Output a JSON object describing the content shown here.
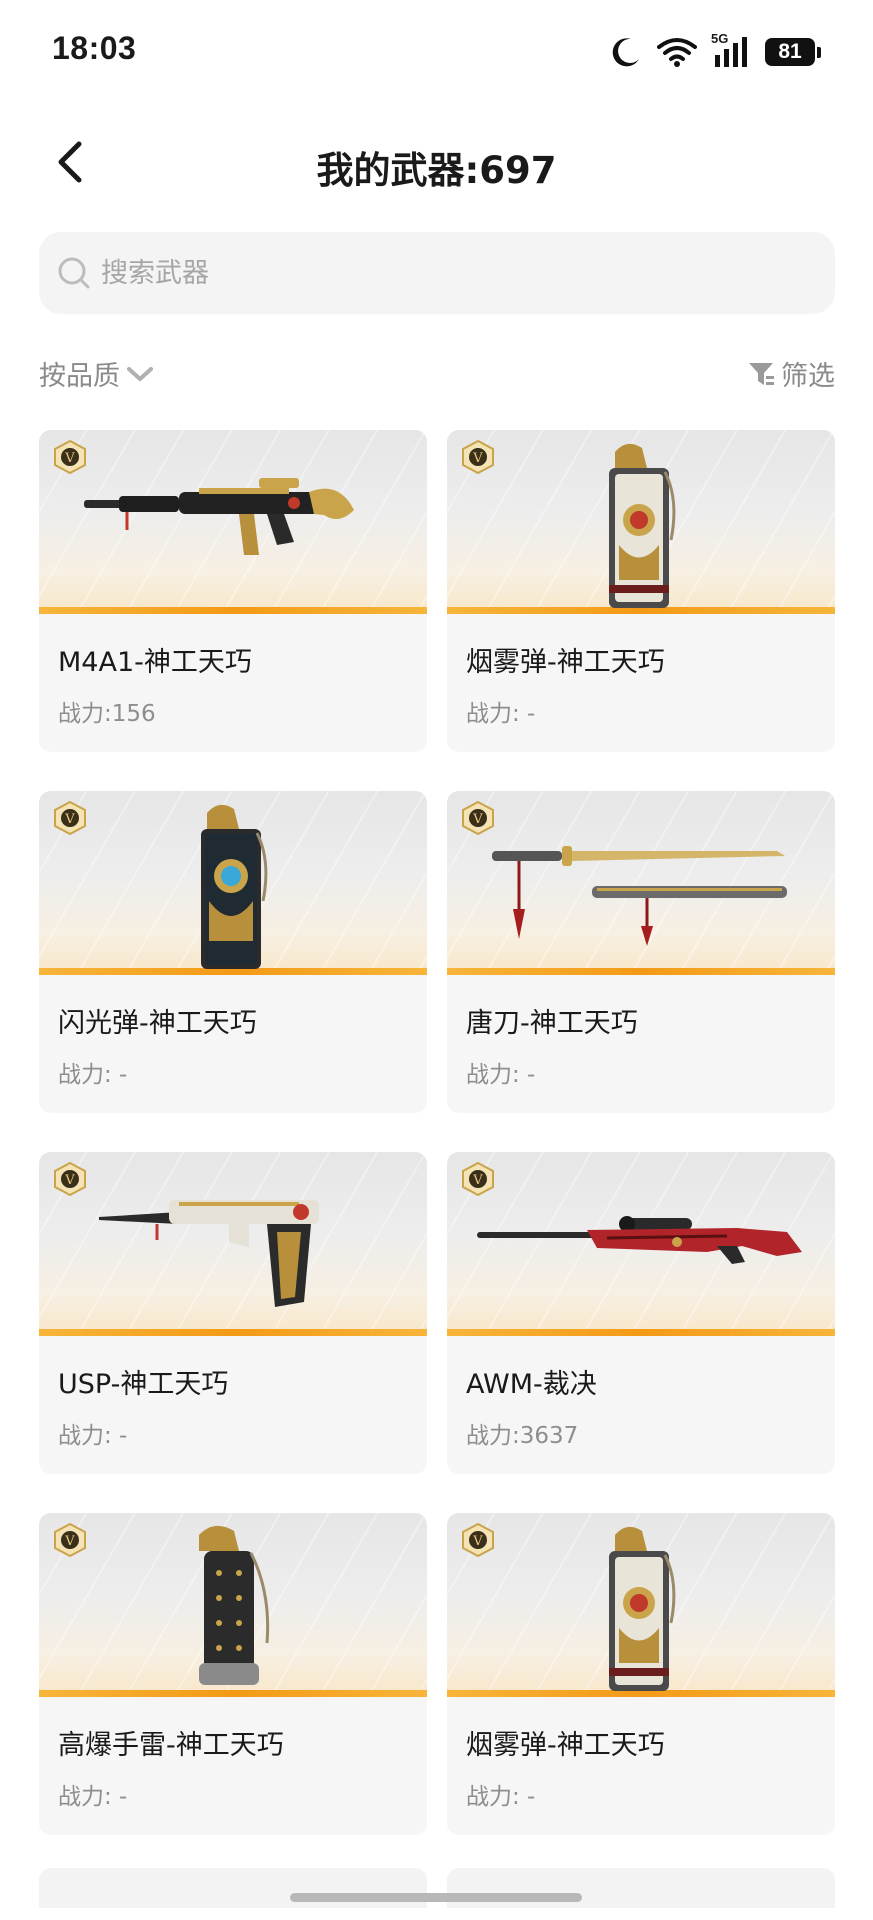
{
  "status_bar": {
    "time": "18:03",
    "icons": [
      "moon-icon",
      "wifi-icon",
      "5g-signal-icon",
      "battery-icon"
    ],
    "network": "5G",
    "battery": "81"
  },
  "header": {
    "title": "我的武器:697",
    "back_icon": "chevron-left-icon"
  },
  "search": {
    "placeholder": "搜索武器",
    "value": ""
  },
  "controls": {
    "sort_label": "按品质",
    "filter_label": "筛选"
  },
  "weapons": [
    {
      "name": "M4A1-神工天巧",
      "power": "战力:156",
      "art": "rifle-icon"
    },
    {
      "name": "烟雾弹-神工天巧",
      "power": "战力: -",
      "art": "smoke-grenade-icon"
    },
    {
      "name": "闪光弹-神工天巧",
      "power": "战力: -",
      "art": "flash-grenade-icon"
    },
    {
      "name": "唐刀-神工天巧",
      "power": "战力: -",
      "art": "sword-icon"
    },
    {
      "name": "USP-神工天巧",
      "power": "战力: -",
      "art": "pistol-icon"
    },
    {
      "name": "AWM-裁决",
      "power": "战力:3637",
      "art": "sniper-rifle-icon"
    },
    {
      "name": "高爆手雷-神工天巧",
      "power": "战力: -",
      "art": "he-grenade-icon"
    },
    {
      "name": "烟雾弹-神工天巧",
      "power": "战力: -",
      "art": "smoke-grenade-icon"
    }
  ],
  "colors": {
    "accent_bar": "#f39a16",
    "badge_gold": "#c9a44a",
    "card_bg": "#f6f6f6",
    "muted_text": "#8e8e8e"
  }
}
